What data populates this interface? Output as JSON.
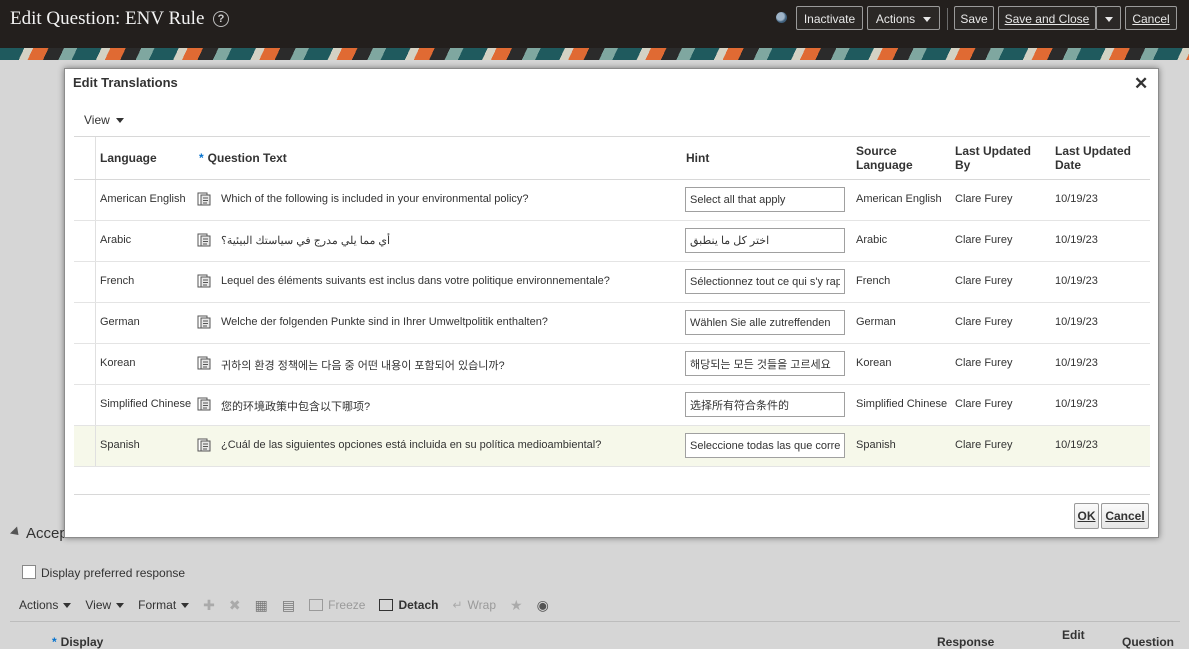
{
  "header": {
    "title": "Edit Question: ENV Rule",
    "help_icon": "question-circle-icon",
    "buttons": {
      "inactivate": "Inactivate",
      "actions": "Actions",
      "save": "Save",
      "save_and_close": "Save and Close",
      "cancel": "Cancel"
    }
  },
  "background_page": {
    "section_title": "Accep",
    "checkbox_label": "Display preferred response",
    "toolbar": {
      "actions": "Actions",
      "view": "View",
      "format": "Format",
      "freeze": "Freeze",
      "detach": "Detach",
      "wrap": "Wrap"
    },
    "columns": {
      "display": "Display",
      "response": "Response",
      "edit": "Edit",
      "question": "Question"
    }
  },
  "dialog": {
    "title": "Edit Translations",
    "close_icon": "close-icon",
    "view_menu": "View",
    "columns": {
      "language": "Language",
      "question_text": "Question Text",
      "hint": "Hint",
      "source_language": "Source Language",
      "last_updated_by": "Last Updated By",
      "last_updated_date": "Last Updated Date"
    },
    "rows": [
      {
        "language": "American English",
        "question": "Which of the following is included in your environmental policy?",
        "hint": "Select all that apply",
        "source": "American English",
        "updated_by": "Clare Furey",
        "updated_date": "10/19/23"
      },
      {
        "language": "Arabic",
        "question": "أي مما يلي مدرج في سياستك البيئية؟",
        "hint": "اختر كل ما ينطبق",
        "source": "Arabic",
        "updated_by": "Clare Furey",
        "updated_date": "10/19/23"
      },
      {
        "language": "French",
        "question": "Lequel des éléments suivants est inclus dans votre politique environnementale?",
        "hint": "Sélectionnez tout ce qui s'y rapporte",
        "source": "French",
        "updated_by": "Clare Furey",
        "updated_date": "10/19/23"
      },
      {
        "language": "German",
        "question": "Welche der folgenden Punkte sind in Ihrer Umweltpolitik enthalten?",
        "hint": "Wählen Sie alle zutreffenden",
        "source": "German",
        "updated_by": "Clare Furey",
        "updated_date": "10/19/23"
      },
      {
        "language": "Korean",
        "question": "귀하의 환경 정책에는 다음 중 어떤 내용이 포함되어 있습니까?",
        "hint": "해당되는 모든 것들을 고르세요",
        "source": "Korean",
        "updated_by": "Clare Furey",
        "updated_date": "10/19/23"
      },
      {
        "language": "Simplified Chinese",
        "question": "您的环境政策中包含以下哪项?",
        "hint": "选择所有符合条件的",
        "source": "Simplified Chinese",
        "updated_by": "Clare Furey",
        "updated_date": "10/19/23"
      },
      {
        "language": "Spanish",
        "question": "¿Cuál de las siguientes opciones está incluida en su política medioambiental?",
        "hint": "Seleccione todas las que correspondan",
        "source": "Spanish",
        "updated_by": "Clare Furey",
        "updated_date": "10/19/23"
      }
    ],
    "selected_row": 6,
    "buttons": {
      "ok": "OK",
      "cancel": "Cancel"
    }
  },
  "colors": {
    "header_bg": "#231f1d",
    "required_marker": "#0572ce",
    "selected_row_bg": "#f6f8ea"
  }
}
